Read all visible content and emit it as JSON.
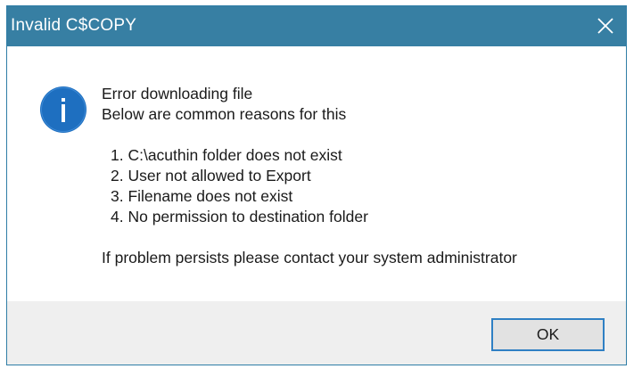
{
  "window": {
    "title": "Invalid C$COPY",
    "close_icon": "close-icon"
  },
  "message": {
    "icon": "info-icon",
    "heading": "Error downloading file",
    "subheading": "Below are common reasons for this",
    "reasons": [
      "1. C:\\acuthin folder does not exist",
      "2. User not allowed to Export",
      "3. Filename does not exist",
      "4. No permission to destination folder"
    ],
    "footer_note": "If problem persists please contact your system administrator"
  },
  "buttons": {
    "ok_label": "OK"
  },
  "colors": {
    "titlebar": "#377fa3",
    "icon": "#1e6fc0",
    "button_border": "#2f80c4",
    "footer_bg": "#efefef"
  }
}
